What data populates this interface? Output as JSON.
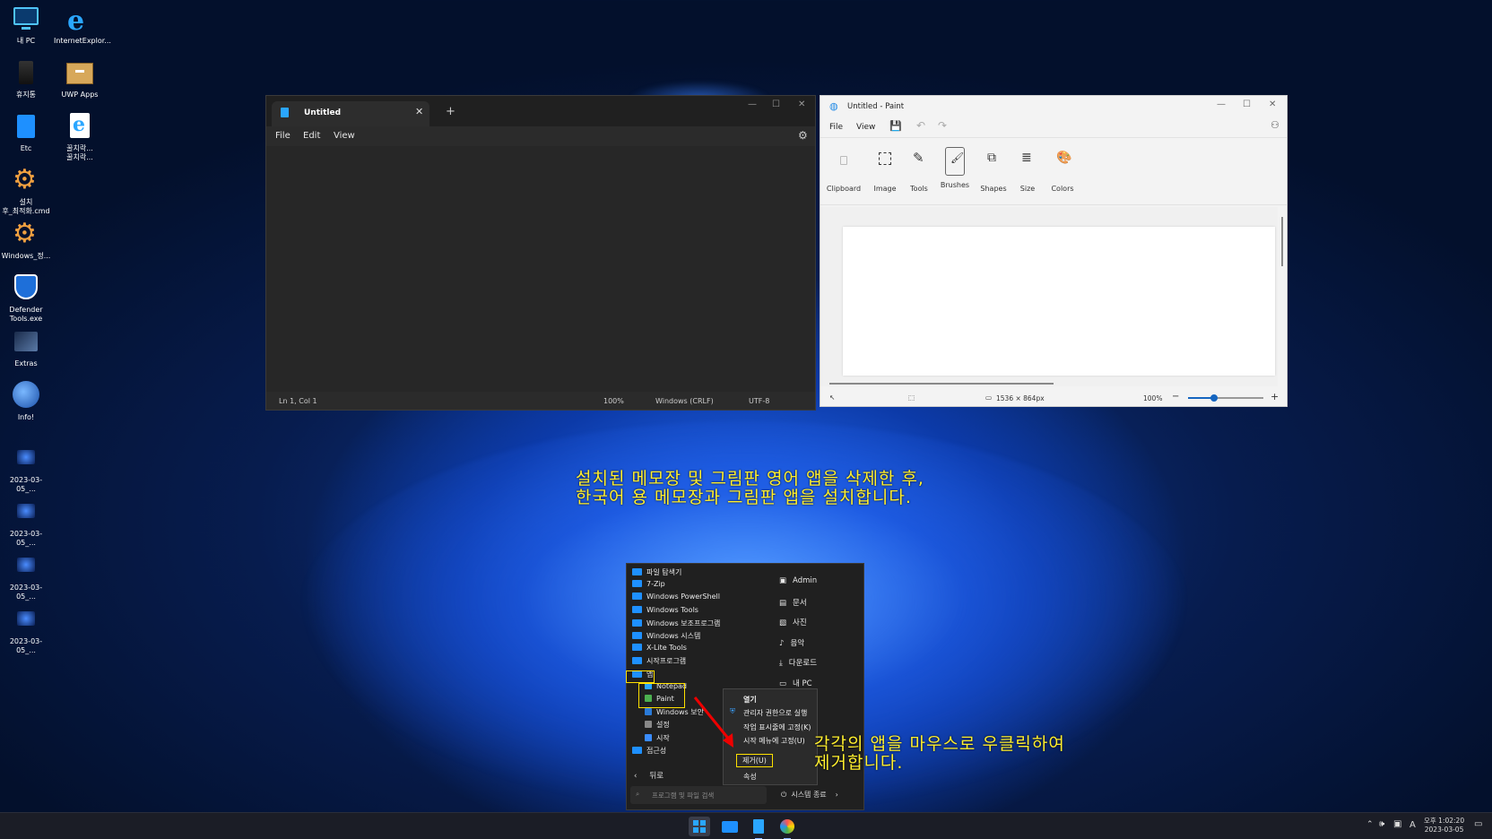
{
  "desktop": {
    "icons": [
      {
        "label": "내 PC",
        "icon": "monitor-icon"
      },
      {
        "label": "InternetExplor...",
        "icon": "ie-icon"
      },
      {
        "label": "휴지통",
        "icon": "recycle-bin-icon"
      },
      {
        "label": "UWP Apps",
        "icon": "box-icon"
      },
      {
        "label": "Etc",
        "icon": "folder-icon"
      },
      {
        "label": "꿀치락...\n꿀치락...",
        "icon": "ie-doc-icon"
      },
      {
        "label": "설치\n후_최적화.cmd",
        "icon": "gear-icon"
      },
      {
        "label": "Windows_정...",
        "icon": "gear-icon"
      },
      {
        "label": "Defender\nTools.exe",
        "icon": "shield-icon"
      },
      {
        "label": "Extras",
        "icon": "image-icon"
      },
      {
        "label": "Info!",
        "icon": "globe-icon"
      },
      {
        "label": "2023-03-05_...",
        "icon": "screenshot-icon"
      },
      {
        "label": "2023-03-05_...",
        "icon": "screenshot-icon"
      },
      {
        "label": "2023-03-05_...",
        "icon": "screenshot-icon"
      },
      {
        "label": "2023-03-05_...",
        "icon": "screenshot-icon"
      }
    ]
  },
  "notepad": {
    "tab_title": "Untitled",
    "menu": [
      "File",
      "Edit",
      "View"
    ],
    "status": {
      "position": "Ln 1, Col 1",
      "zoom": "100%",
      "eol": "Windows (CRLF)",
      "encoding": "UTF-8"
    }
  },
  "paint": {
    "title": "Untitled - Paint",
    "menu": [
      "File",
      "View"
    ],
    "tools": [
      "Clipboard",
      "Image",
      "Tools",
      "Brushes",
      "Shapes",
      "Size",
      "Colors"
    ],
    "status": {
      "canvas_size": "1536 × 864px",
      "zoom": "100%"
    }
  },
  "start_menu": {
    "apps": [
      "파일 탐색기",
      "7-Zip",
      "Windows PowerShell",
      "Windows Tools",
      "Windows 보조프로그램",
      "Windows 시스템",
      "X-Lite Tools",
      "시작프로그램",
      "앱",
      "Notepad",
      "Paint",
      "Windows 보안",
      "설정",
      "시작",
      "접근성"
    ],
    "places": [
      "Admin",
      "문서",
      "사진",
      "음악",
      "다운로드",
      "내 PC"
    ],
    "back": "뒤로",
    "search_placeholder": "프로그램 및 파일 검색",
    "power": "시스템 종료"
  },
  "context_menu": [
    "열기",
    "관리자 권한으로 실행",
    "작업 표시줄에 고정(K)",
    "시작 메뉴에 고정(U)",
    "제거(U)",
    "속성"
  ],
  "annotations": {
    "top": [
      "설치된 메모장 및 그림판 영어 앱을 삭제한 후,",
      "한국어 용 메모장과 그림판 앱을 설치합니다."
    ],
    "bottom": [
      "각각의 앱을 마우스로 우클릭하여",
      "제거합니다."
    ]
  },
  "taskbar": {
    "time": "오후 1:02:20",
    "date": "2023-03-05",
    "lang": "A"
  }
}
